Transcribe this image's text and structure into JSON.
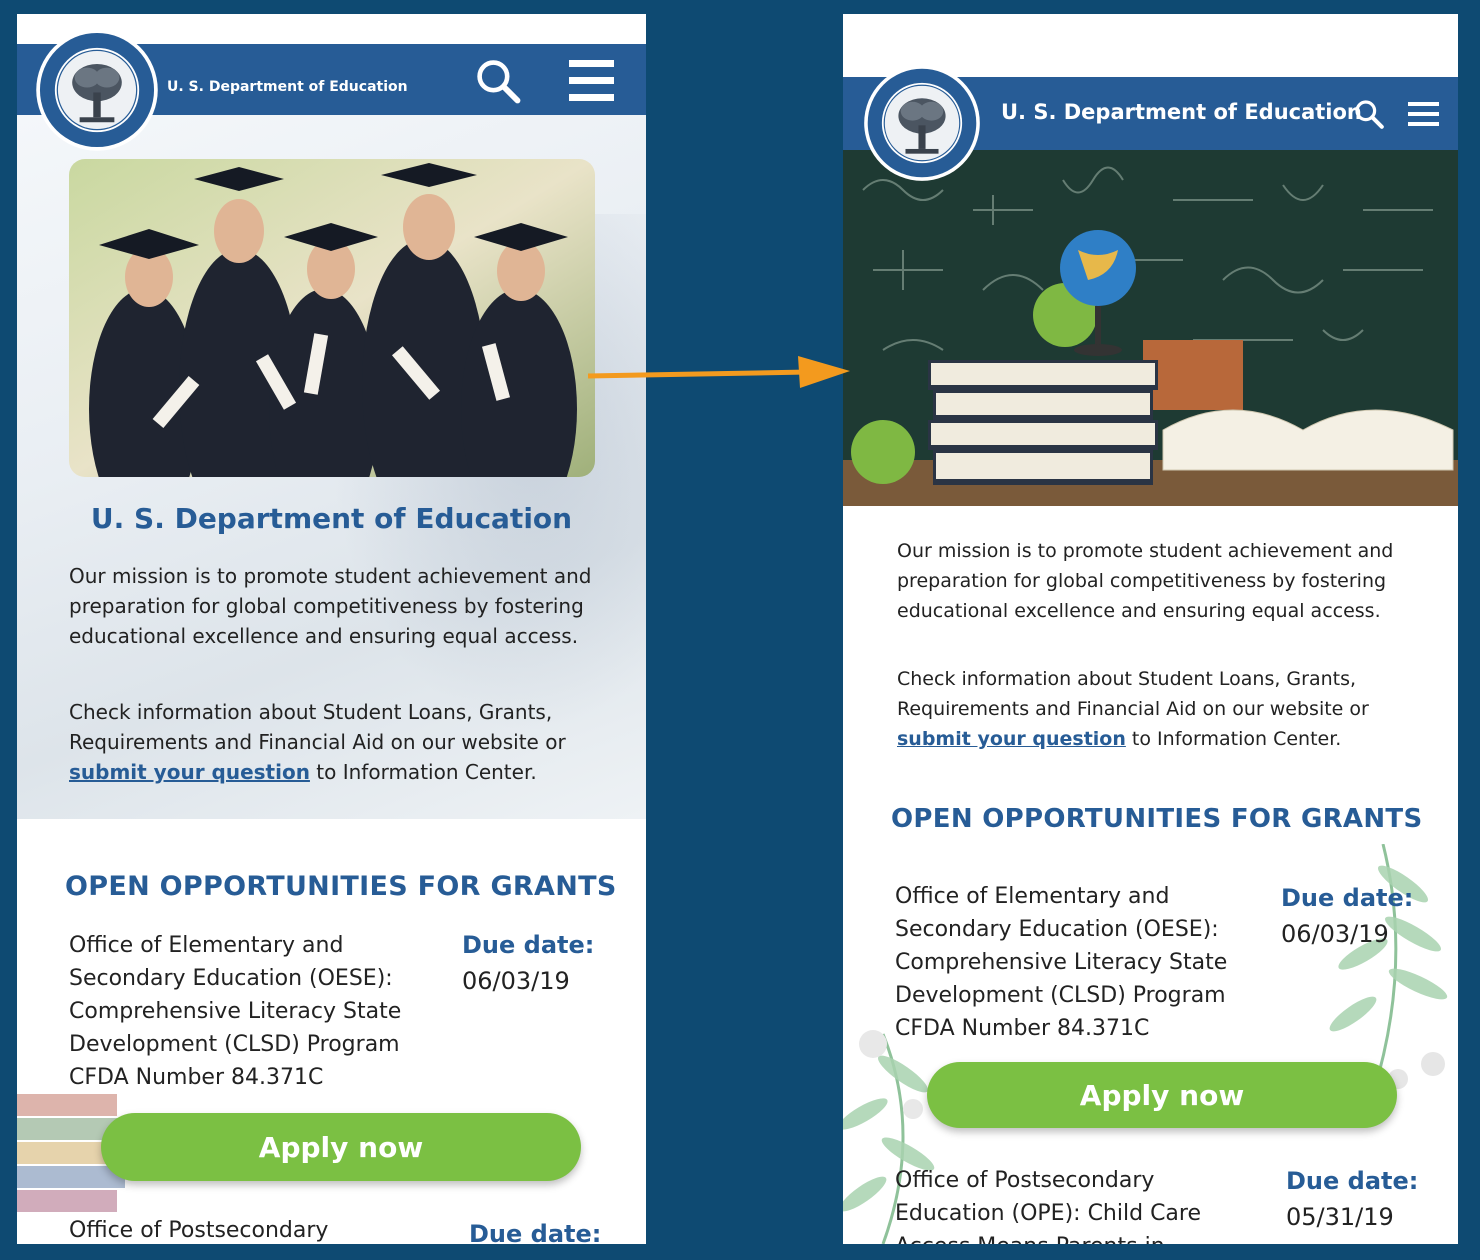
{
  "colors": {
    "brand_blue": "#275c96",
    "apply_green": "#7bc043",
    "arrow_orange": "#f39a1e"
  },
  "left": {
    "header": {
      "brand": "U. S. Department of Education",
      "search_icon": "search-icon",
      "menu_icon": "hamburger-menu-icon"
    },
    "hero_title": "U. S. Department of Education",
    "mission": "Our mission is to promote student achievement and preparation for global competitiveness by fostering educational excellence and ensuring equal access.",
    "info_before": "Check information about Student Loans, Grants, Requirements and Financial Aid on our website or ",
    "info_link": "submit your question",
    "info_after": " to Information Center.",
    "grants_title": "OPEN OPPORTUNITIES FOR GRANTS",
    "grant1": {
      "text": "Office of Elementary and Secondary Education (OESE): Comprehensive Literacy State Development (CLSD) Program CFDA Number 84.371C",
      "due_label": "Due date:",
      "due_date": "06/03/19",
      "apply": "Apply now"
    },
    "grant2": {
      "text": "Office of Postsecondary",
      "due_label": "Due date:"
    }
  },
  "right": {
    "header": {
      "brand": "U. S. Department of Education",
      "search_icon": "search-icon",
      "menu_icon": "hamburger-menu-icon"
    },
    "mission": "Our mission is to promote student achievement and preparation for global competitiveness by fostering educational excellence and ensuring equal access.",
    "info_before": "Check information about Student Loans, Grants, Requirements and Financial Aid on our website or ",
    "info_link": "submit your question",
    "info_after": " to Information Center.",
    "grants_title": "OPEN OPPORTUNITIES FOR GRANTS",
    "grant1": {
      "text": "Office of Elementary and Secondary Education (OESE): Comprehensive Literacy State Development (CLSD) Program CFDA Number 84.371C",
      "due_label": "Due date:",
      "due_date": "06/03/19",
      "apply": "Apply now"
    },
    "grant2": {
      "text": "Office of Postsecondary Education (OPE): Child Care Access Means Parents in",
      "due_label": "Due date:",
      "due_date": "05/31/19"
    }
  }
}
